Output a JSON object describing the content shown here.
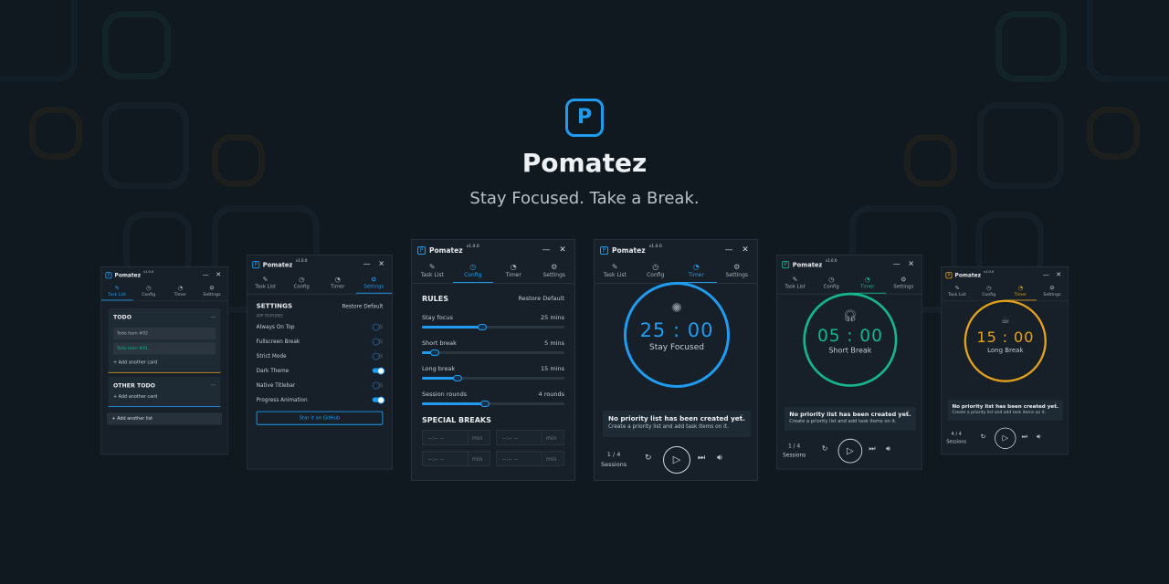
{
  "hero": {
    "logo_letter": "P",
    "title": "Pomatez",
    "tagline": "Stay Focused. Take a Break."
  },
  "app": {
    "name": "Pomatez",
    "version": "v1.0.0",
    "minimize": "—",
    "close": "✕"
  },
  "tabs": [
    "Task List",
    "Config",
    "Timer",
    "Settings"
  ],
  "colors": {
    "focus": "#1f9cf0",
    "short_break": "#16b58c",
    "long_break": "#e3a21a",
    "background": "#111920"
  },
  "tasklist": {
    "lists": [
      {
        "title": "TODO",
        "menu": "···",
        "cards": [
          "Todo item #02",
          "Todo item #01"
        ],
        "add_card": "Add another card"
      },
      {
        "title": "OTHER TODO",
        "menu": "···",
        "add_card": "Add another card"
      }
    ],
    "add_list": "Add another list"
  },
  "settings": {
    "title": "SETTINGS",
    "restore": "Restore Default",
    "section": "APP FEATURES",
    "items": [
      {
        "label": "Always On Top",
        "on": false
      },
      {
        "label": "Fullscreen Break",
        "on": false
      },
      {
        "label": "Strict Mode",
        "on": false
      },
      {
        "label": "Dark Theme",
        "on": true
      },
      {
        "label": "Native Titlebar",
        "on": false
      },
      {
        "label": "Progress Animation",
        "on": true
      }
    ],
    "github": "Star it on GitHub"
  },
  "config": {
    "title": "RULES",
    "restore": "Restore Default",
    "rules": [
      {
        "label": "Stay focus",
        "value": "25 mins",
        "fraction": 0.42
      },
      {
        "label": "Short break",
        "value": "5 mins",
        "fraction": 0.09
      },
      {
        "label": "Long break",
        "value": "15 mins",
        "fraction": 0.25
      },
      {
        "label": "Session rounds",
        "value": "4 rounds",
        "fraction": 0.44
      }
    ],
    "special": "SPECIAL BREAKS",
    "time_placeholder": "--:-- --",
    "unit": "min"
  },
  "timers": [
    {
      "time": "25 : 00",
      "label": "Stay Focused",
      "sessions": "1 / 4",
      "icon": "focus-icon"
    },
    {
      "time": "05 : 00",
      "label": "Short Break",
      "sessions": "1 / 4",
      "icon": "headphones-icon"
    },
    {
      "time": "15 : 00",
      "label": "Long Break",
      "sessions": "4 / 4",
      "icon": "coffee-icon"
    }
  ],
  "priority": {
    "title": "No priority list has been created yet.",
    "sub": "Create a priority list and add task items on it.",
    "menu": "⋮"
  },
  "sessions_label": "Sessions"
}
